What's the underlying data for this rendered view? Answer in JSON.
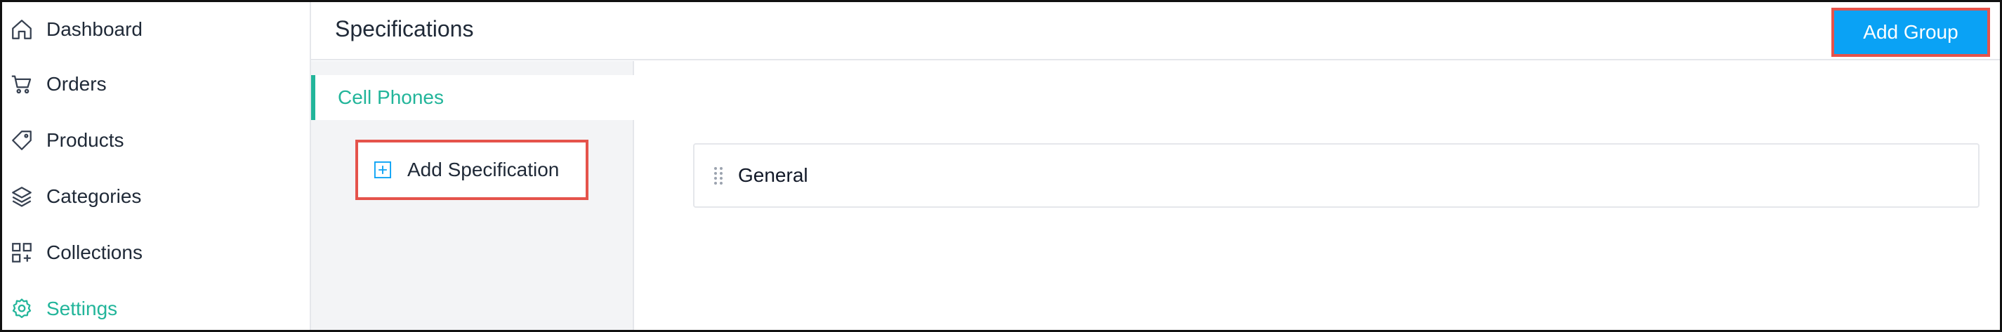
{
  "sidebar": {
    "items": [
      {
        "label": "Dashboard",
        "icon": "home-icon"
      },
      {
        "label": "Orders",
        "icon": "cart-icon"
      },
      {
        "label": "Products",
        "icon": "tag-icon"
      },
      {
        "label": "Categories",
        "icon": "layers-icon"
      },
      {
        "label": "Collections",
        "icon": "grid-plus-icon"
      },
      {
        "label": "Settings",
        "icon": "gear-icon",
        "active": true
      }
    ]
  },
  "header": {
    "title": "Specifications",
    "add_group_label": "Add Group"
  },
  "category_panel": {
    "selected_category": "Cell Phones",
    "add_specification_label": "Add Specification"
  },
  "groups": [
    {
      "label": "General"
    }
  ],
  "colors": {
    "accent": "#22b59a",
    "primary_button": "#0aa2f5",
    "highlight_border": "#e5534b"
  }
}
